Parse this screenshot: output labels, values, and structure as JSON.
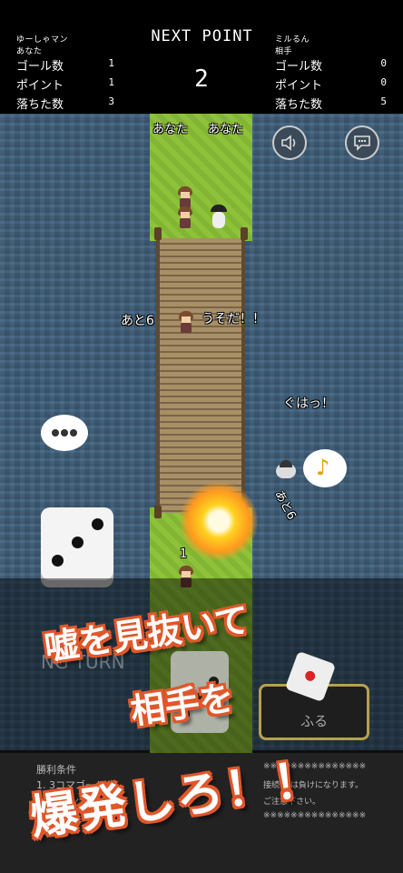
{
  "scoreboard": {
    "left": {
      "player_name": "ゆーしゃマン",
      "player_tag": "あなた",
      "rows": [
        {
          "label": "ゴール数",
          "value": "1"
        },
        {
          "label": "ポイント",
          "value": "1"
        },
        {
          "label": "落ちた数",
          "value": "3"
        }
      ]
    },
    "center": {
      "title": "NEXT POINT",
      "value": "2"
    },
    "right": {
      "player_name": "ミルるん",
      "player_tag": "相手",
      "rows": [
        {
          "label": "ゴール数",
          "value": "0"
        },
        {
          "label": "ポイント",
          "value": "0"
        },
        {
          "label": "落ちた数",
          "value": "5"
        }
      ]
    }
  },
  "field": {
    "top_labels": [
      "あなた",
      "あなた"
    ],
    "ato_label": "あと6",
    "speech_lie": "うそだ！！",
    "speech_guha": "ぐはっ！",
    "ato_rotated": "あと6",
    "marker_number": "1",
    "turn_text": "NG TURN"
  },
  "buttons": {
    "sound_icon": "speaker-icon",
    "chat_icon": "chat-bubble-icon",
    "roll_label": "ふる"
  },
  "rules": {
    "heading": "勝利条件",
    "items": [
      "1. 3コマゴール",
      "2. ポイン"
    ],
    "notice_lines": [
      "※※※※※※※※※※※※※※※",
      "接続の   は負けになります。",
      "ご注意下さい。",
      "※※※※※※※※※※※※※※※"
    ]
  },
  "promo": {
    "line1": "嘘を見抜いて",
    "line2": "相手を",
    "line3": "爆発しろ！！"
  },
  "colors": {
    "accent": "#e0572a",
    "grass": "#8ec23a",
    "water": "#416080"
  }
}
